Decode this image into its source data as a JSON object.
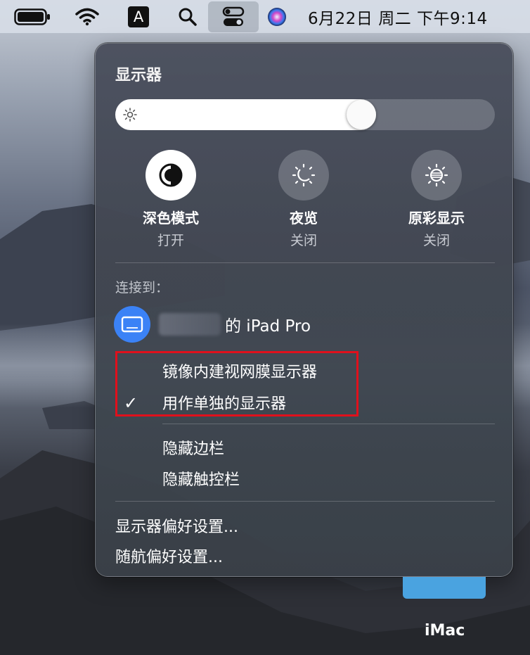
{
  "menubar": {
    "input_method": "A",
    "clock": "6月22日 周二 下午9:14",
    "icons": [
      "battery-icon",
      "wifi-icon",
      "input-method-icon",
      "search-icon",
      "control-center-icon",
      "siri-icon"
    ]
  },
  "panel": {
    "title": "显示器",
    "brightness": 0.66,
    "modes": [
      {
        "label": "深色模式",
        "status": "打开",
        "icon": "dark-mode-icon",
        "active": true
      },
      {
        "label": "夜览",
        "status": "关闭",
        "icon": "night-shift-icon",
        "active": false
      },
      {
        "label": "原彩显示",
        "status": "关闭",
        "icon": "true-tone-icon",
        "active": false
      }
    ],
    "connect_label": "连接到：",
    "device_suffix": "的 iPad Pro",
    "options": [
      {
        "label": "镜像内建视网膜显示器",
        "checked": false
      },
      {
        "label": "用作单独的显示器",
        "checked": true
      }
    ],
    "check_mark": "✓",
    "extra_options": [
      "隐藏边栏",
      "隐藏触控栏"
    ],
    "links": [
      "显示器偏好设置...",
      "随航偏好设置..."
    ]
  },
  "desktop": {
    "imac_label": "iMac"
  },
  "colors": {
    "accent": "#3b82f6",
    "highlight_box": "#e0101c"
  }
}
